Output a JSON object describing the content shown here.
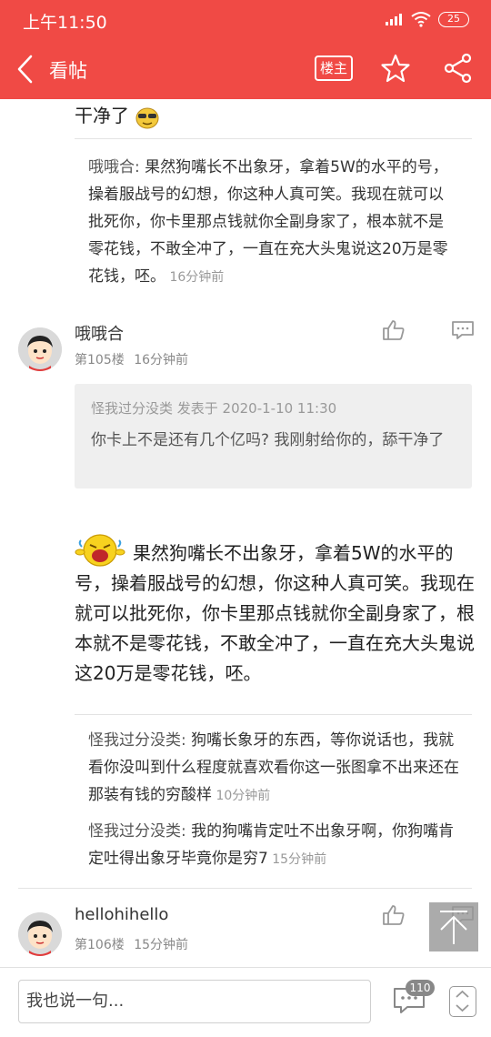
{
  "status_bar": {
    "time": "上午11:50",
    "battery": "25"
  },
  "nav": {
    "title": "看帖",
    "louzhu_label": "楼主"
  },
  "top_fragment": {
    "text": "干净了"
  },
  "reply_1": {
    "name": "哦哦合:",
    "text": " 果然狗嘴长不出象牙，拿着5W的水平的号，操着服战号的幻想，你这种人真可笑。我现在就可以批死你，你卡里那点钱就你全副身家了，根本就不是零花钱，不敢全冲了，一直在充大头鬼说这20万是零花钱，呸。",
    "time": " 16分钟前"
  },
  "post_105": {
    "username": "哦哦合",
    "floor": "第105楼",
    "time": "16分钟前",
    "quote_meta": "怪我过分没类 发表于 2020-1-10 11:30",
    "quote_text": "你卡上不是还有几个亿吗? 我刚射给你的，舔干净了",
    "body": "果然狗嘴长不出象牙，拿着5W的水平的号，操着服战号的幻想，你这种人真可笑。我现在就可以批死你，你卡里那点钱就你全副身家了，根本就不是零花钱，不敢全冲了，一直在充大头鬼说这20万是零花钱，呸。"
  },
  "replies_105": [
    {
      "name": "怪我过分没类:",
      "text": " 狗嘴长象牙的东西，等你说话也，我就看你没叫到什么程度就喜欢看你这一张图拿不出来还在那装有钱的穷酸样",
      "time": " 10分钟前"
    },
    {
      "name": "怪我过分没类:",
      "text": " 我的狗嘴肯定吐不出象牙啊，你狗嘴肯定吐得出象牙毕竟你是穷7",
      "time": " 15分钟前"
    }
  ],
  "post_106": {
    "username": "hellohihello",
    "floor": "第106楼",
    "time": "15分钟前"
  },
  "bottom_bar": {
    "input_placeholder": "我也说一句...",
    "comment_count": "110"
  },
  "colors": {
    "header_bg": "#f04a45"
  }
}
